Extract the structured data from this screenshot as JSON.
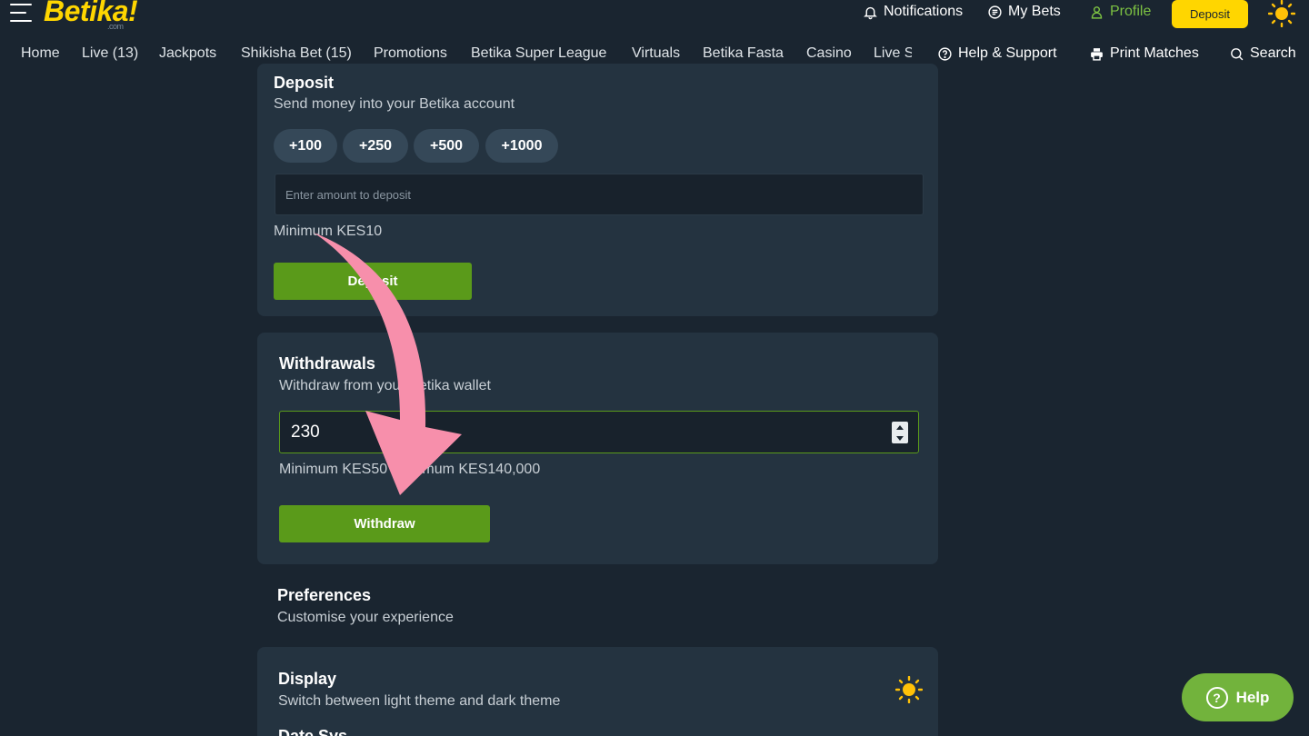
{
  "header": {
    "logo": "Betika!",
    "logo_suffix": ".com",
    "notifications": "Notifications",
    "my_bets": "My Bets",
    "profile": "Profile",
    "deposit": "Deposit"
  },
  "nav": {
    "items": [
      "Home",
      "Live (13)",
      "Jackpots",
      "Shikisha Bet (15)",
      "Promotions",
      "Betika Super League",
      "Virtuals",
      "Betika Fasta",
      "Casino",
      "Live S"
    ],
    "help_support": "Help & Support",
    "print_matches": "Print Matches",
    "search": "Search"
  },
  "deposit_card": {
    "title": "Deposit",
    "subtitle": "Send money into your Betika account",
    "chips": [
      "+100",
      "+250",
      "+500",
      "+1000"
    ],
    "input_placeholder": "Enter amount to deposit",
    "minimum": "Minimum KES10",
    "button": "Deposit"
  },
  "withdraw_card": {
    "title": "Withdrawals",
    "subtitle": "Withdraw from your Betika wallet",
    "input_value": "230",
    "limits": "Minimum KES50 Maximum KES140,000",
    "button": "Withdraw"
  },
  "preferences": {
    "title": "Preferences",
    "subtitle": "Customise your experience"
  },
  "display_card": {
    "title": "Display",
    "subtitle": "Switch between light theme and dark theme",
    "next_title": "Date Sys"
  },
  "help_fab": {
    "label": "Help",
    "glyph": "?"
  },
  "colors": {
    "background": "#1a2530",
    "card": "#243340",
    "brand_yellow": "#ffd600",
    "brand_green": "#5a9a1a",
    "profile_green": "#7cc142",
    "annotation_pink": "#f78fab"
  }
}
